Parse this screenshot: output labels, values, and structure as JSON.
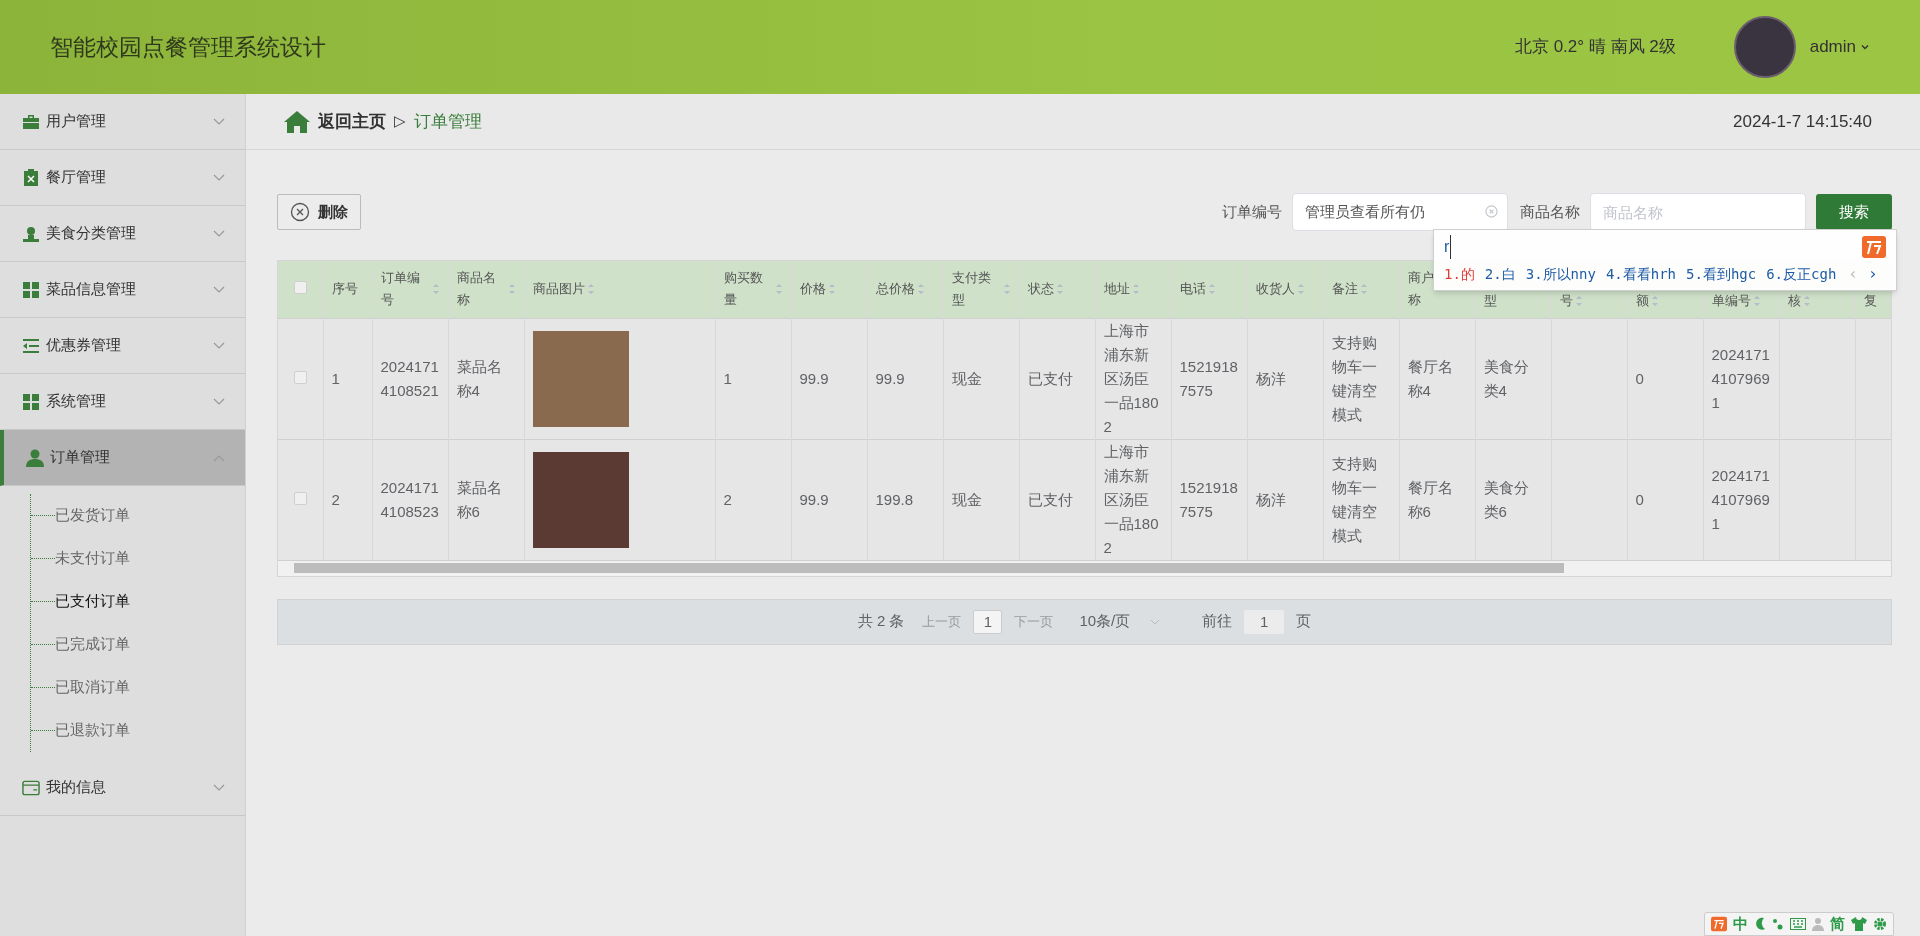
{
  "header": {
    "title": "智能校园点餐管理系统设计",
    "weather": "北京 0.2° 晴 南风 2级",
    "user": "admin"
  },
  "sidebar": {
    "items": [
      {
        "label": "用户管理",
        "expanded": false,
        "selected": false
      },
      {
        "label": "餐厅管理",
        "expanded": false,
        "selected": false
      },
      {
        "label": "美食分类管理",
        "expanded": false,
        "selected": false
      },
      {
        "label": "菜品信息管理",
        "expanded": false,
        "selected": false
      },
      {
        "label": "优惠券管理",
        "expanded": false,
        "selected": false
      },
      {
        "label": "系统管理",
        "expanded": false,
        "selected": false
      },
      {
        "label": "订单管理",
        "expanded": true,
        "selected": true,
        "children": [
          {
            "label": "已发货订单",
            "selected": false
          },
          {
            "label": "未支付订单",
            "selected": false
          },
          {
            "label": "已支付订单",
            "selected": true
          },
          {
            "label": "已完成订单",
            "selected": false
          },
          {
            "label": "已取消订单",
            "selected": false
          },
          {
            "label": "已退款订单",
            "selected": false
          }
        ]
      },
      {
        "label": "我的信息",
        "expanded": false,
        "selected": false
      }
    ]
  },
  "breadcrumb": {
    "home": "返回主页",
    "separator": "▷",
    "current": "订单管理"
  },
  "datetime": "2024-1-7 14:15:40",
  "toolbar": {
    "delete": "删除",
    "filters": [
      {
        "label": "订单编号",
        "value": "管理员查看所有仍"
      },
      {
        "label": "商品名称",
        "placeholder": "商品名称"
      }
    ],
    "search": "搜索"
  },
  "table": {
    "all_checked": false,
    "columns": [
      {
        "lines": [
          "序号"
        ],
        "sortable": false,
        "covered": false
      },
      {
        "lines": [
          "订单编号"
        ],
        "sortable": true,
        "covered": false
      },
      {
        "lines": [
          "商品名称"
        ],
        "sortable": true,
        "covered": false
      },
      {
        "lines": [
          "商品图片"
        ],
        "sortable": true,
        "covered": false
      },
      {
        "lines": [
          "购买数量"
        ],
        "sortable": true,
        "covered": false
      },
      {
        "lines": [
          "价格"
        ],
        "sortable": true,
        "covered": false
      },
      {
        "lines": [
          "总价格"
        ],
        "sortable": true,
        "covered": false
      },
      {
        "lines": [
          "支付类型"
        ],
        "sortable": true,
        "covered": false
      },
      {
        "lines": [
          "状态"
        ],
        "sortable": true,
        "covered": false
      },
      {
        "lines": [
          "地址"
        ],
        "sortable": true,
        "covered": false
      },
      {
        "lines": [
          "电话"
        ],
        "sortable": true,
        "covered": false
      },
      {
        "lines": [
          "收货人"
        ],
        "sortable": true,
        "covered": false
      },
      {
        "lines": [
          "备注"
        ],
        "sortable": true,
        "covered": false
      },
      {
        "lines": [
          "商户",
          "称"
        ],
        "sortable": false,
        "covered": false
      },
      {
        "lines": [
          "型"
        ],
        "sortable": false,
        "covered": true
      },
      {
        "lines": [
          "号"
        ],
        "sortable": true,
        "covered": true
      },
      {
        "lines": [
          "额"
        ],
        "sortable": true,
        "covered": true
      },
      {
        "lines": [
          "单编号"
        ],
        "sortable": true,
        "covered": true
      },
      {
        "lines": [
          "核"
        ],
        "sortable": true,
        "covered": true
      },
      {
        "lines": [
          "复"
        ],
        "sortable": false,
        "covered": true
      }
    ],
    "rows": [
      {
        "checked": false,
        "cells": [
          {
            "kind": "text",
            "text": "1"
          },
          {
            "kind": "text",
            "text": "20241714108521"
          },
          {
            "kind": "text",
            "text": "菜品名称4"
          },
          {
            "kind": "image"
          },
          {
            "kind": "text",
            "text": "1"
          },
          {
            "kind": "text",
            "text": "99.9"
          },
          {
            "kind": "text",
            "text": "99.9"
          },
          {
            "kind": "text",
            "text": "现金"
          },
          {
            "kind": "text",
            "text": "已支付"
          },
          {
            "kind": "text",
            "text": "上海市浦东新区汤臣一品1802"
          },
          {
            "kind": "text",
            "text": "15219187575"
          },
          {
            "kind": "text",
            "text": "杨洋"
          },
          {
            "kind": "text",
            "text": "支持购物车一键清空模式"
          },
          {
            "kind": "text",
            "text": "餐厅名称4"
          },
          {
            "kind": "text",
            "text": "美食分类4"
          },
          {
            "kind": "empty"
          },
          {
            "kind": "text",
            "text": "0"
          },
          {
            "kind": "text",
            "text": "202417141079691"
          },
          {
            "kind": "empty"
          },
          {
            "kind": "empty"
          }
        ]
      },
      {
        "checked": false,
        "cells": [
          {
            "kind": "text",
            "text": "2"
          },
          {
            "kind": "text",
            "text": "20241714108523"
          },
          {
            "kind": "text",
            "text": "菜品名称6"
          },
          {
            "kind": "image"
          },
          {
            "kind": "text",
            "text": "2"
          },
          {
            "kind": "text",
            "text": "99.9"
          },
          {
            "kind": "text",
            "text": "199.8"
          },
          {
            "kind": "text",
            "text": "现金"
          },
          {
            "kind": "text",
            "text": "已支付"
          },
          {
            "kind": "text",
            "text": "上海市浦东新区汤臣一品1802"
          },
          {
            "kind": "text",
            "text": "15219187575"
          },
          {
            "kind": "text",
            "text": "杨洋"
          },
          {
            "kind": "text",
            "text": "支持购物车一键清空模式"
          },
          {
            "kind": "text",
            "text": "餐厅名称6"
          },
          {
            "kind": "text",
            "text": "美食分类6"
          },
          {
            "kind": "empty"
          },
          {
            "kind": "text",
            "text": "0"
          },
          {
            "kind": "text",
            "text": "202417141079691"
          },
          {
            "kind": "empty"
          },
          {
            "kind": "empty"
          }
        ]
      }
    ]
  },
  "pagination": {
    "total": "共 2 条",
    "prev": "上一页",
    "page": "1",
    "next": "下一页",
    "size": "10条/页",
    "goto": "前往",
    "goto_value": "1",
    "unit": "页"
  },
  "ime": {
    "input": "r",
    "candidates": [
      {
        "text": "1.的",
        "selected": true
      },
      {
        "text": "2.白",
        "selected": false
      },
      {
        "text": "3.所以nny",
        "selected": false
      },
      {
        "text": "4.看看hrh",
        "selected": false
      },
      {
        "text": "5.看到hgc",
        "selected": false
      },
      {
        "text": "6.反正cgh",
        "selected": false
      }
    ],
    "prev": "‹",
    "next": "›",
    "status": [
      "中",
      "简"
    ]
  }
}
